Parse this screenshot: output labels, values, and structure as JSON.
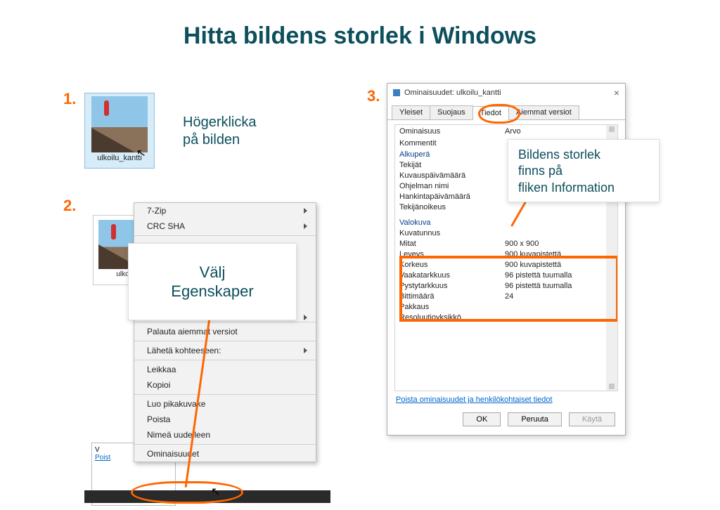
{
  "title": "Hitta bildens storlek i Windows",
  "steps": {
    "s1": "1.",
    "s2": "2.",
    "s3": "3."
  },
  "thumb": {
    "caption": "ulkoilu_kantti"
  },
  "instr1": {
    "l1": "Högerklicka",
    "l2": "på bilden"
  },
  "context_menu": {
    "zip": "7-Zip",
    "crc": "CRC SHA",
    "pad_item": "",
    "restore": "Palauta aiemmat versiot",
    "sendto": "Lähetä kohteeseen:",
    "cut": "Leikkaa",
    "copy": "Kopioi",
    "shortcut": "Luo pikakuvake",
    "delete": "Poista",
    "rename": "Nimeä uudelleen",
    "properties": "Ominaisuudet"
  },
  "callout2": {
    "l1": "Välj",
    "l2": "Egenskaper"
  },
  "edge": {
    "link": "Poist",
    "label": "V"
  },
  "prop_dialog": {
    "title": "Ominaisuudet: ulkoilu_kantti",
    "tabs": {
      "general": "Yleiset",
      "security": "Suojaus",
      "details": "Tiedot",
      "prev": "Aiemmat versiot"
    },
    "hdr_prop": "Ominaisuus",
    "hdr_val": "Arvo",
    "rows": {
      "comment": "Kommentit",
      "section_origin": "Alkuperä",
      "authors": "Tekijät",
      "date_taken": "Kuvauspäivämäärä",
      "program": "Ohjelman nimi",
      "acquired": "Hankintapäivämäärä",
      "copyright": "Tekijänoikeus",
      "section_photo": "Valokuva",
      "image_id": "Kuvatunnus",
      "dimensions_k": "Mitat",
      "dimensions_v": "900 x 900",
      "width_k": "Leveys",
      "width_v": "900 kuvapistettä",
      "height_k": "Korkeus",
      "height_v": "900 kuvapistettä",
      "hres_k": "Vaakatarkkuus",
      "hres_v": "96 pistettä tuumalla",
      "vres_k": "Pystytarkkuus",
      "vres_v": "96 pistettä tuumalla",
      "bitdepth_k": "Bittimäärä",
      "bitdepth_v": "24",
      "compression": "Pakkaus",
      "resunit": "Resoluutioyksikkö"
    },
    "remove_link": "Poista ominaisuudet ja henkilökohtaiset tiedot",
    "buttons": {
      "ok": "OK",
      "cancel": "Peruuta",
      "apply": "Käytä"
    }
  },
  "callout3": {
    "l1": "Bildens storlek",
    "l2": "finns på",
    "l3": "fliken Information"
  }
}
